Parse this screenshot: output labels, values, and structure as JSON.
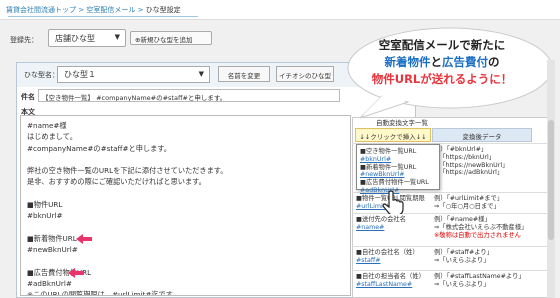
{
  "breadcrumb": {
    "items": [
      "賃貸会社間流通トップ",
      "空室配信メール",
      "ひな型設定"
    ],
    "separator": ">"
  },
  "registrar": {
    "label": "登録先：",
    "selected": "店舗ひな型",
    "new_button": "新規ひな型を追加"
  },
  "template": {
    "label": "ひな型名：",
    "selected": "ひな型１",
    "rename_button": "名前を変更",
    "illust_button": "イチオシのひな型"
  },
  "subject": {
    "label": "件名",
    "value": "【空き物件一覧】 #companyName#の#staff#と申します。"
  },
  "body": {
    "label": "本文",
    "lines": [
      "#name#様",
      "はじめまして。",
      "#companyName#の#staff#と申します。",
      "",
      "弊社の空き物件一覧のURLを下記に添付させていただきます。",
      "是非、おすすめの際にご確認いただければと思います。",
      "",
      "■物件URL",
      "#bknUrl#",
      "",
      "■新着物件URL",
      "#newBknUrl#",
      "",
      "■広告費付物件URL",
      "#adBknUrl#",
      "※このURLの閲覧期限は、#urlLimit#迄です。"
    ]
  },
  "sidebar_table": {
    "header_top": "自動変換文字一覧",
    "click_label": "↓↓クリックで挿入↓↓",
    "col2_header": "変換後データ",
    "popup_lines": [
      "■空き物件一覧URL",
      "#bknUrl#",
      "■新着物件一覧URL",
      "#newBknUrl#",
      "■広告費付物件一覧URL",
      "#adBknUrl#"
    ],
    "rows": [
      {
        "left": "■空き物件一覧URL\n#bknUrl#",
        "right": "例）「#bknUrl#」\n⇒「https://bknUrl」\n⇒「https://newBknUrl」\n⇒「https://adBknUrl」"
      },
      {
        "left": "■物件一覧URL閲覧期限\n#urlLimit#",
        "right": "例）「#urlLimit#まで」\n⇒「○年○月○日まで」"
      },
      {
        "left": "■送付先の会社名\n#name#",
        "right": "例）「#name#様」\n⇒「株式会社いえらぶ不動産様」\n※敬称は自動で出力されません"
      },
      {
        "left": "■自社の会社名（姓）\n#staff#",
        "right": "例）「#staff#より」\n⇒「いえらぶより」"
      },
      {
        "left": "■自社の担当者名（姓）\n#staffLastName#",
        "right": "例）「#staffLastName#より」\n⇒「いえらぶより」"
      }
    ]
  },
  "callout": {
    "line1": "空室配信メールで新たに",
    "line2_a": "新着物件",
    "line2_b": "と",
    "line2_c": "広告費付",
    "line2_d": "の",
    "line3": "物件URLが送れるように！",
    "color_accent": "#e8343c",
    "color_blue": "#1a6fc4"
  }
}
